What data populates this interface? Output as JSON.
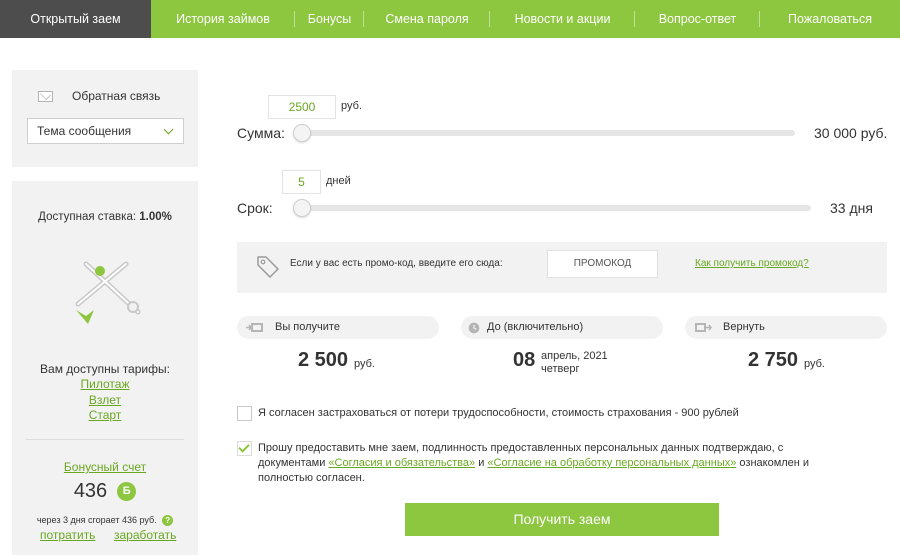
{
  "nav": {
    "tabs": [
      {
        "label": "Открытый заем"
      },
      {
        "label": "История займов"
      },
      {
        "label": "Бонусы"
      },
      {
        "label": "Смена пароля"
      },
      {
        "label": "Новости и акции"
      },
      {
        "label": "Вопрос-ответ"
      },
      {
        "label": "Пожаловаться"
      }
    ]
  },
  "sidebar": {
    "feedback_label": "Обратная связь",
    "topic_select": "Тема сообщения",
    "rate_label": "Доступная ставка:",
    "rate_value": "1.00%",
    "tariffs_title": "Вам доступны тарифы:",
    "tariffs": [
      {
        "label": "Пилотаж"
      },
      {
        "label": "Взлет"
      },
      {
        "label": "Старт"
      }
    ],
    "bonus_title": "Бонусный счет",
    "bonus_value": "436",
    "bonus_badge": "Б",
    "bonus_burn": "через 3 дня сгорает 436 руб.",
    "bonus_help": "?",
    "spend_link": "потратить",
    "earn_link": "заработать"
  },
  "loan": {
    "sum_label": "Сумма:",
    "sum_value": "2500",
    "sum_unit": "руб.",
    "sum_max": "30 000 руб.",
    "sum_fraction": 0,
    "term_label": "Срок:",
    "term_value": "5",
    "term_unit": "дней",
    "term_max": "33 дня",
    "term_fraction": 0
  },
  "promo": {
    "text": "Если у вас есть промо-код, введите его сюда:",
    "placeholder": "ПРОМОКОД",
    "link": "Как получить промокод?"
  },
  "summary": {
    "receive_label": "Вы получите",
    "receive_value": "2 500",
    "receive_unit": "руб.",
    "until_label": "До (включительно)",
    "until_day": "08",
    "until_month": "апрель, 2021",
    "until_weekday": "четверг",
    "return_label": "Вернуть",
    "return_value": "2 750",
    "return_unit": "руб."
  },
  "consents": {
    "insurance": "Я согласен застраховаться от потери трудоспособности, стоимость страхования - 900 рублей",
    "insurance_checked": false,
    "agree_part1": "Прошу предоставить мне заем, подлинность предоставленных персональных данных подтверждаю, с документами",
    "agree_link1": "«Согласия и обязательства»",
    "agree_and": "и",
    "agree_link2": "«Согласие на обработку персональных данных»",
    "agree_part2": "ознакомлен и полностью согласен.",
    "agree_checked": true
  },
  "submit_label": "Получить заем",
  "colors": {
    "accent": "#8dc63f",
    "link": "#6aa721",
    "active_tab": "#4d4d4d"
  }
}
